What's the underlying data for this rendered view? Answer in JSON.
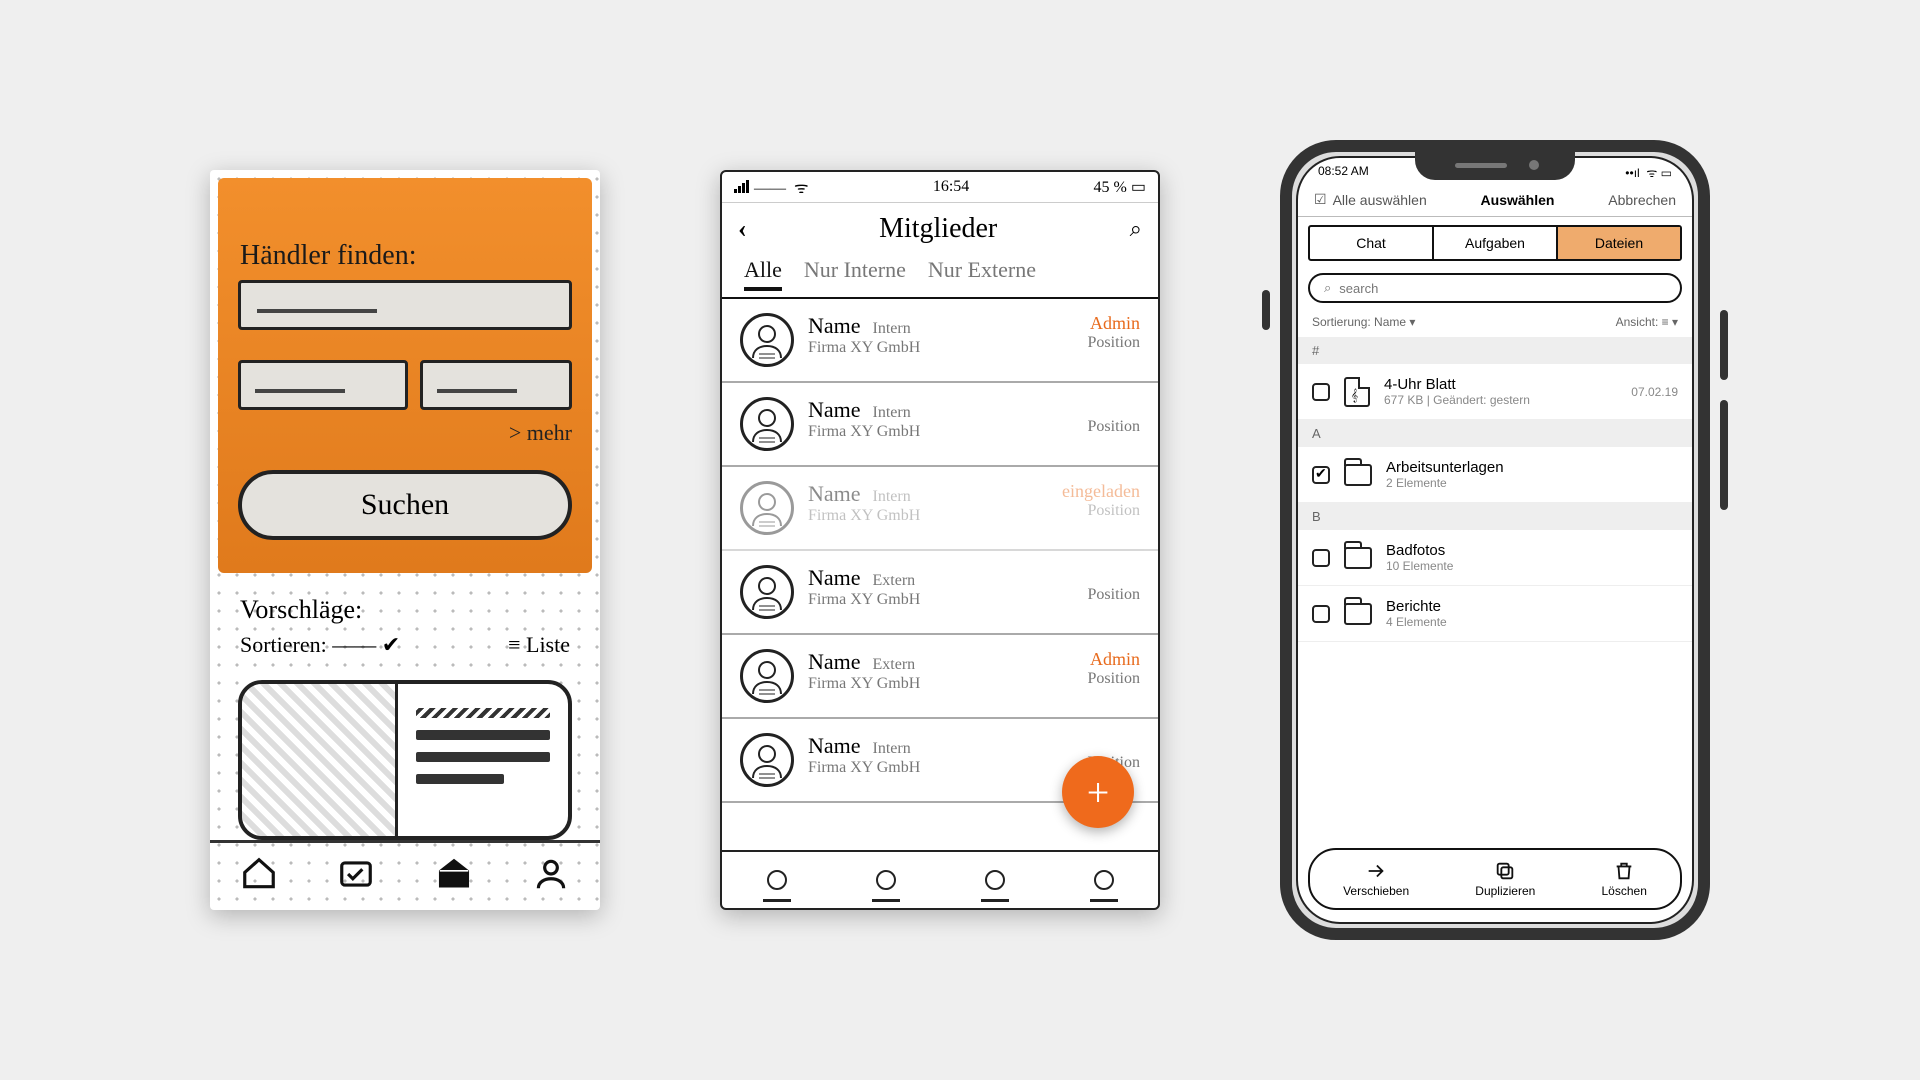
{
  "screen1": {
    "heading": "Händler finden:",
    "more": "> mehr",
    "search_button": "Suchen",
    "suggestions_heading": "Vorschläge:",
    "sort_label": "Sortieren:",
    "list_toggle": "≡ Liste"
  },
  "screen2": {
    "status": {
      "time": "16:54",
      "battery": "45 %"
    },
    "title": "Mitglieder",
    "tabs": {
      "all": "Alle",
      "internal": "Nur Interne",
      "external": "Nur Externe"
    },
    "firm": "Firma XY GmbH",
    "position_label": "Position",
    "members": [
      {
        "name": "Name",
        "tag": "Intern",
        "role": "Admin"
      },
      {
        "name": "Name",
        "tag": "Intern",
        "role": ""
      },
      {
        "name": "Name",
        "tag": "Intern",
        "role": "eingeladen",
        "dim": true
      },
      {
        "name": "Name",
        "tag": "Extern",
        "role": ""
      },
      {
        "name": "Name",
        "tag": "Extern",
        "role": "Admin"
      },
      {
        "name": "Name",
        "tag": "Intern",
        "role": ""
      }
    ]
  },
  "screen3": {
    "status_time": "08:52 AM",
    "topbar": {
      "select_all": "Alle auswählen",
      "title": "Auswählen",
      "cancel": "Abbrechen"
    },
    "segments": {
      "chat": "Chat",
      "tasks": "Aufgaben",
      "files": "Dateien"
    },
    "search_placeholder": "search",
    "sort_label": "Sortierung:",
    "sort_value": "Name",
    "view_label": "Ansicht:",
    "sections": [
      {
        "key": "#",
        "items": [
          {
            "type": "file",
            "name": "4-Uhr Blatt",
            "sub": "677 KB | Geändert: gestern",
            "date": "07.02.19",
            "checked": false
          }
        ]
      },
      {
        "key": "A",
        "items": [
          {
            "type": "folder",
            "name": "Arbeitsunterlagen",
            "sub": "2 Elemente",
            "checked": true
          }
        ]
      },
      {
        "key": "B",
        "items": [
          {
            "type": "folder",
            "name": "Badfotos",
            "sub": "10 Elemente",
            "checked": false
          },
          {
            "type": "folder",
            "name": "Berichte",
            "sub": "4 Elemente",
            "checked": false
          }
        ]
      }
    ],
    "actions": {
      "move": "Verschieben",
      "duplicate": "Duplizieren",
      "delete": "Löschen"
    }
  }
}
